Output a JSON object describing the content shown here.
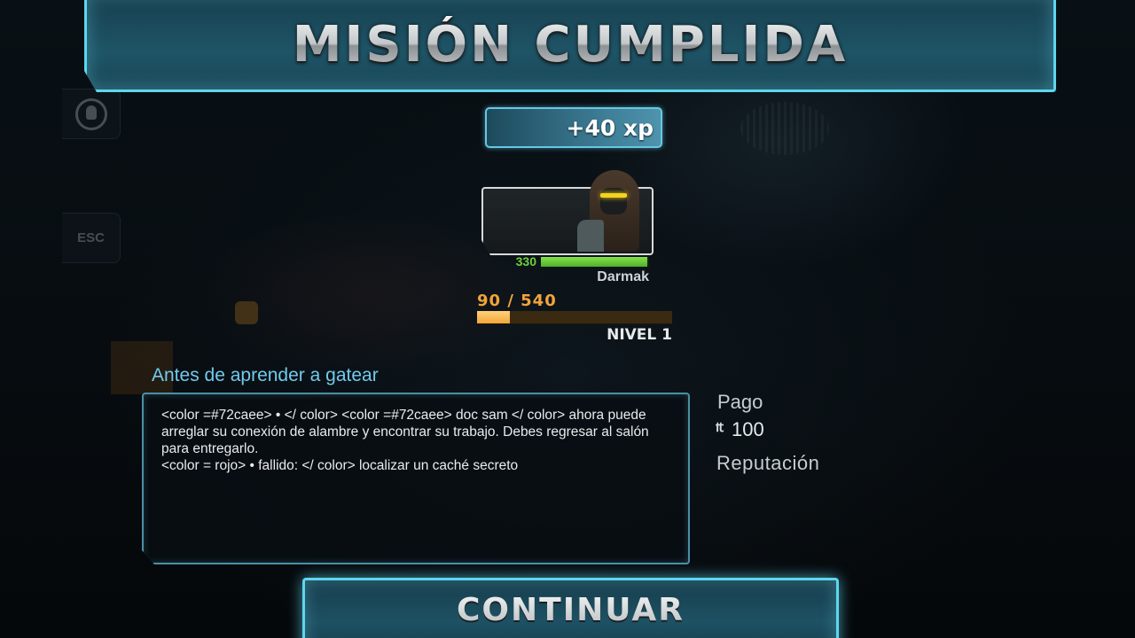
{
  "header": {
    "title": "MISIÓN CUMPLIDA"
  },
  "side_buttons": {
    "esc_label": "ESC",
    "profile_icon": "profile-icon"
  },
  "xp_reward": {
    "label": "+40 xp"
  },
  "character": {
    "name": "Darmak",
    "hp_value": "330",
    "hp_fill_fraction": 0.98,
    "hp_color": "#6fd13a",
    "portrait_icon": "hooded-character-portrait"
  },
  "level_progress": {
    "text": "90 / 540",
    "current": 90,
    "max": 540,
    "level_label": "NIVEL 1",
    "bar_color": "#f2a53a"
  },
  "mission": {
    "title": "Antes de aprender a gatear",
    "title_color": "#72caee",
    "description": "<color =#72caee> • </ color> <color =#72caee> doc sam </ color> ahora puede arreglar su conexión de alambre y encontrar su trabajo. Debes regresar al salón para entregarlo.\n<color = rojo> • fallido: </ color> localizar un caché secreto"
  },
  "rewards": {
    "pay_label": "Pago",
    "pay_icon": "credits-icon",
    "pay_value": "100",
    "reputation_label": "Reputación"
  },
  "footer": {
    "continue_label": "CONTINUAR"
  },
  "colors": {
    "accent": "#5ed6ef",
    "panel": "#1d5163"
  }
}
